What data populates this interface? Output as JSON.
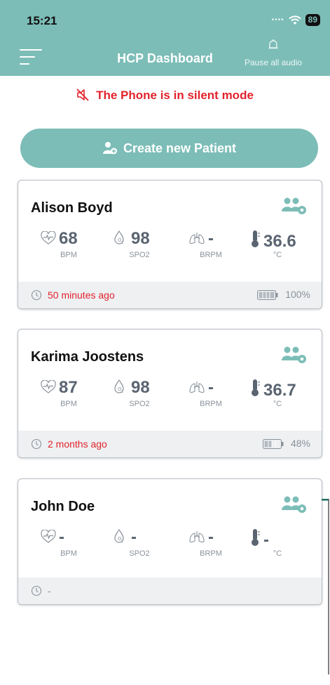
{
  "status_bar": {
    "time": "15:21",
    "battery": "89"
  },
  "nav": {
    "title": "HCP Dashboard",
    "pause_label": "Pause all audio"
  },
  "silent_message": "The Phone is in silent mode",
  "create_button_label": "Create new Patient",
  "patients": [
    {
      "name": "Alison Boyd",
      "bpm": "68",
      "bpm_unit": "BPM",
      "spo2": "98",
      "spo2_unit": "SPO2",
      "brpm": "-",
      "brpm_unit": "BRPM",
      "temp": "36.6",
      "temp_unit": "°C",
      "last_seen": "50 minutes ago",
      "battery": "100%",
      "battery_level": 1.0
    },
    {
      "name": "Karima Joostens",
      "bpm": "87",
      "bpm_unit": "BPM",
      "spo2": "98",
      "spo2_unit": "SPO2",
      "brpm": "-",
      "brpm_unit": "BRPM",
      "temp": "36.7",
      "temp_unit": "°C",
      "last_seen": "2 months ago",
      "battery": "48%",
      "battery_level": 0.48
    },
    {
      "name": "John Doe",
      "bpm": "-",
      "bpm_unit": "BPM",
      "spo2": "-",
      "spo2_unit": "SPO2",
      "brpm": "-",
      "brpm_unit": "BRPM",
      "temp": "-",
      "temp_unit": "°C",
      "last_seen": "-",
      "battery": "",
      "battery_level": null
    }
  ],
  "colors": {
    "accent": "#7cbdb7",
    "alert": "#e2232c",
    "value": "#5a6471",
    "muted": "#8a929b"
  },
  "icons": [
    "menu-icon",
    "bell-icon",
    "wifi-icon",
    "muted-speaker-icon",
    "add-user-icon",
    "users-settings-icon",
    "heart-icon",
    "drop-o2-icon",
    "lungs-icon",
    "thermometer-icon",
    "clock-icon",
    "battery-icon"
  ]
}
